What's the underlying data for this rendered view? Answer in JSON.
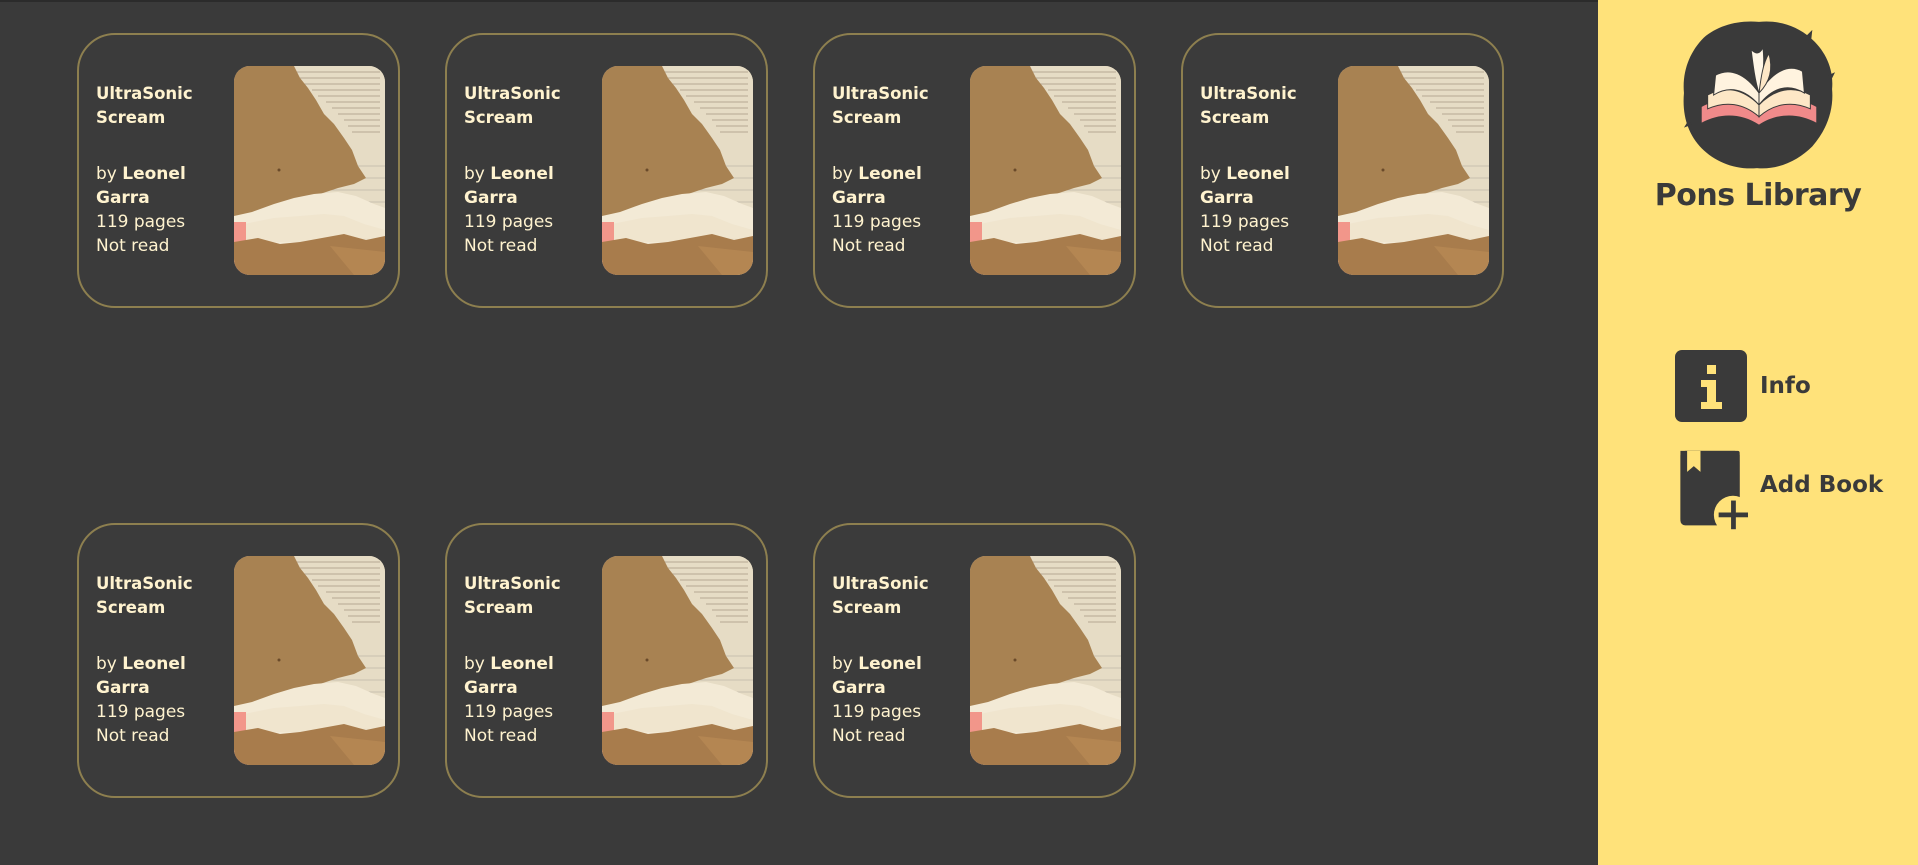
{
  "books": [
    {
      "title": "UltraSonic Scream",
      "by": "by",
      "author": "Leonel Garra",
      "pages": "119 pages",
      "status": "Not read"
    },
    {
      "title": "UltraSonic Scream",
      "by": "by",
      "author": "Leonel Garra",
      "pages": "119 pages",
      "status": "Not read"
    },
    {
      "title": "UltraSonic Scream",
      "by": "by",
      "author": "Leonel Garra",
      "pages": "119 pages",
      "status": "Not read"
    },
    {
      "title": "UltraSonic Scream",
      "by": "by",
      "author": "Leonel Garra",
      "pages": "119 pages",
      "status": "Not read"
    },
    {
      "title": "UltraSonic Scream",
      "by": "by",
      "author": "Leonel Garra",
      "pages": "119 pages",
      "status": "Not read"
    },
    {
      "title": "UltraSonic Scream",
      "by": "by",
      "author": "Leonel Garra",
      "pages": "119 pages",
      "status": "Not read"
    },
    {
      "title": "UltraSonic Scream",
      "by": "by",
      "author": "Leonel Garra",
      "pages": "119 pages",
      "status": "Not read"
    }
  ],
  "sidebar": {
    "brand": "Pons Library",
    "logo_icon": "open-book-icon",
    "nav": [
      {
        "label": "Info",
        "icon": "info-icon"
      },
      {
        "label": "Add Book",
        "icon": "add-bookmark-icon"
      }
    ]
  },
  "colors": {
    "background": "#3a3a3a",
    "sidebar": "#ffe27a",
    "card_border": "#8d7f4f",
    "card_text": "#fff3cf"
  }
}
